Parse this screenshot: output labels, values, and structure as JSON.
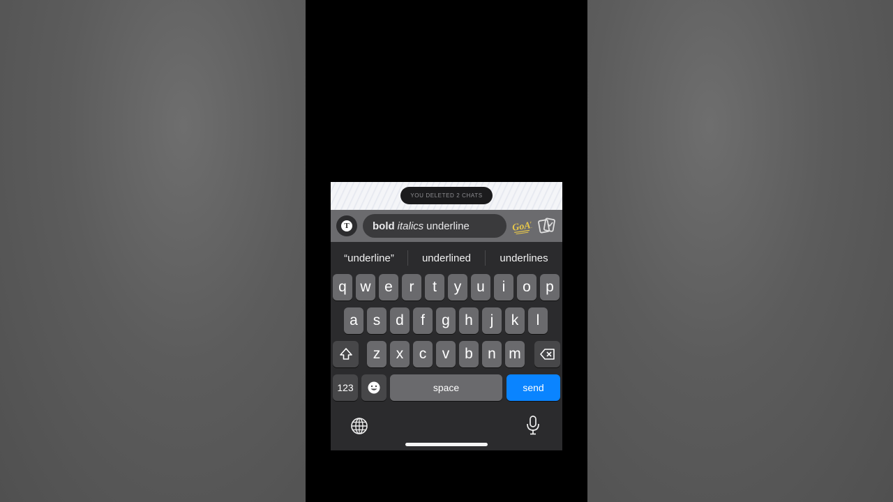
{
  "toast": {
    "text": "YOU DELETED 2 CHATS"
  },
  "compose": {
    "input_bold": "bold",
    "input_italic": "italics",
    "input_plain": "underline",
    "goat_label": "GOAT"
  },
  "suggestions": [
    "“underline”",
    "underlined",
    "underlines"
  ],
  "keys": {
    "row1": [
      "q",
      "w",
      "e",
      "r",
      "t",
      "y",
      "u",
      "i",
      "o",
      "p"
    ],
    "row2": [
      "a",
      "s",
      "d",
      "f",
      "g",
      "h",
      "j",
      "k",
      "l"
    ],
    "row3": [
      "z",
      "x",
      "c",
      "v",
      "b",
      "n",
      "m"
    ],
    "numbers": "123",
    "space": "space",
    "send": "send"
  },
  "icons": {
    "text_format": "text-format-icon",
    "bitmoji": "goat-sticker-icon",
    "cards": "cards-icon",
    "shift": "shift-icon",
    "backspace": "backspace-icon",
    "emoji": "emoji-icon",
    "globe": "globe-icon",
    "mic": "microphone-icon"
  },
  "colors": {
    "send": "#0a84ff",
    "goat": "#e8c84a",
    "keyboard_bg": "#2b2b2d"
  }
}
